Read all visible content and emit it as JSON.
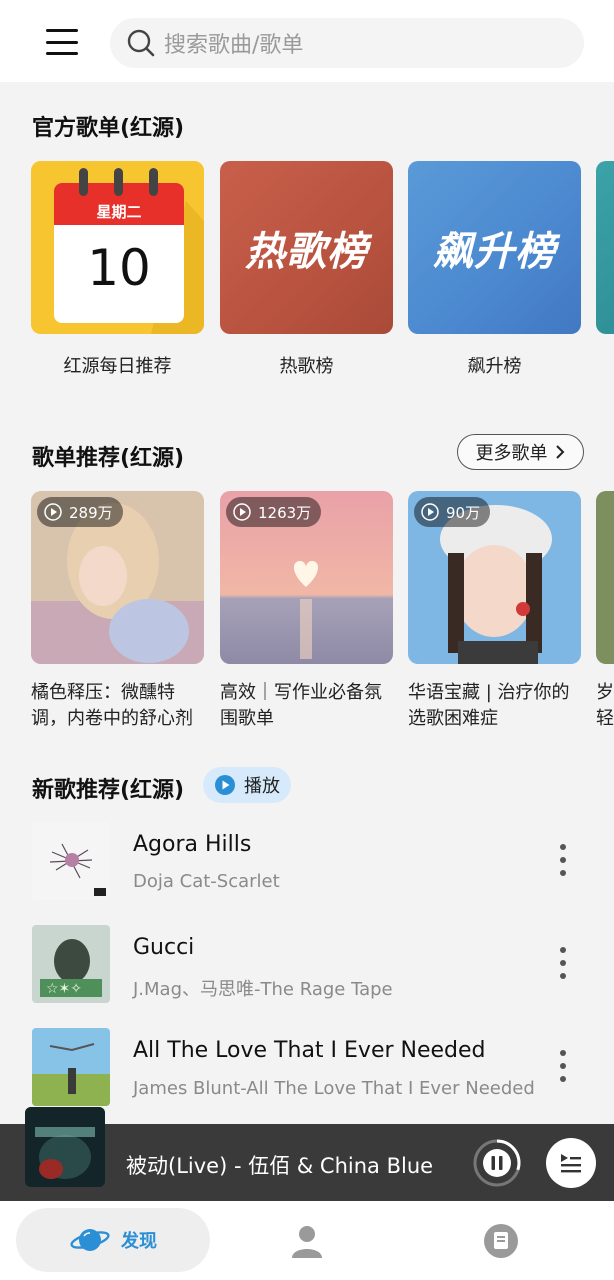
{
  "search": {
    "placeholder": "搜索歌曲/歌单"
  },
  "official": {
    "title": "官方歌单(红源)",
    "calendar": {
      "weekday": "星期二",
      "day": "10"
    },
    "cards": [
      {
        "label": "红源每日推荐",
        "cover_text": ""
      },
      {
        "label": "热歌榜",
        "cover_text": "热歌榜"
      },
      {
        "label": "飙升榜",
        "cover_text": "飙升榜"
      }
    ]
  },
  "recommend": {
    "title": "歌单推荐(红源)",
    "more_label": "更多歌单",
    "playlists": [
      {
        "plays": "289万",
        "title": "橘色释压：微醺特调，内卷中的舒心剂"
      },
      {
        "plays": "1263万",
        "title": "高效｜写作业必备氛围歌单"
      },
      {
        "plays": "90万",
        "title": "华语宝藏 | 治疗你的选歌困难症"
      },
      {
        "title": "岁轻"
      }
    ]
  },
  "new_songs": {
    "title": "新歌推荐(红源)",
    "play_label": "播放",
    "songs": [
      {
        "title": "Agora Hills",
        "subtitle": "Doja Cat-Scarlet"
      },
      {
        "title": "Gucci",
        "subtitle": "J.Mag、马思唯-The Rage Tape"
      },
      {
        "title": "All The Love That I Ever Needed",
        "subtitle": "James Blunt-All The Love That I Ever Needed"
      }
    ]
  },
  "player": {
    "now_playing": "被动(Live)  -  伍佰 & China Blue",
    "progress": 0.3
  },
  "nav": {
    "discover_label": "发现"
  },
  "colors": {
    "accent": "#2b8fd6",
    "player_bg": "#3a3a3a",
    "calendar_red": "#e8302a",
    "calendar_bg": "#f7c52f"
  }
}
